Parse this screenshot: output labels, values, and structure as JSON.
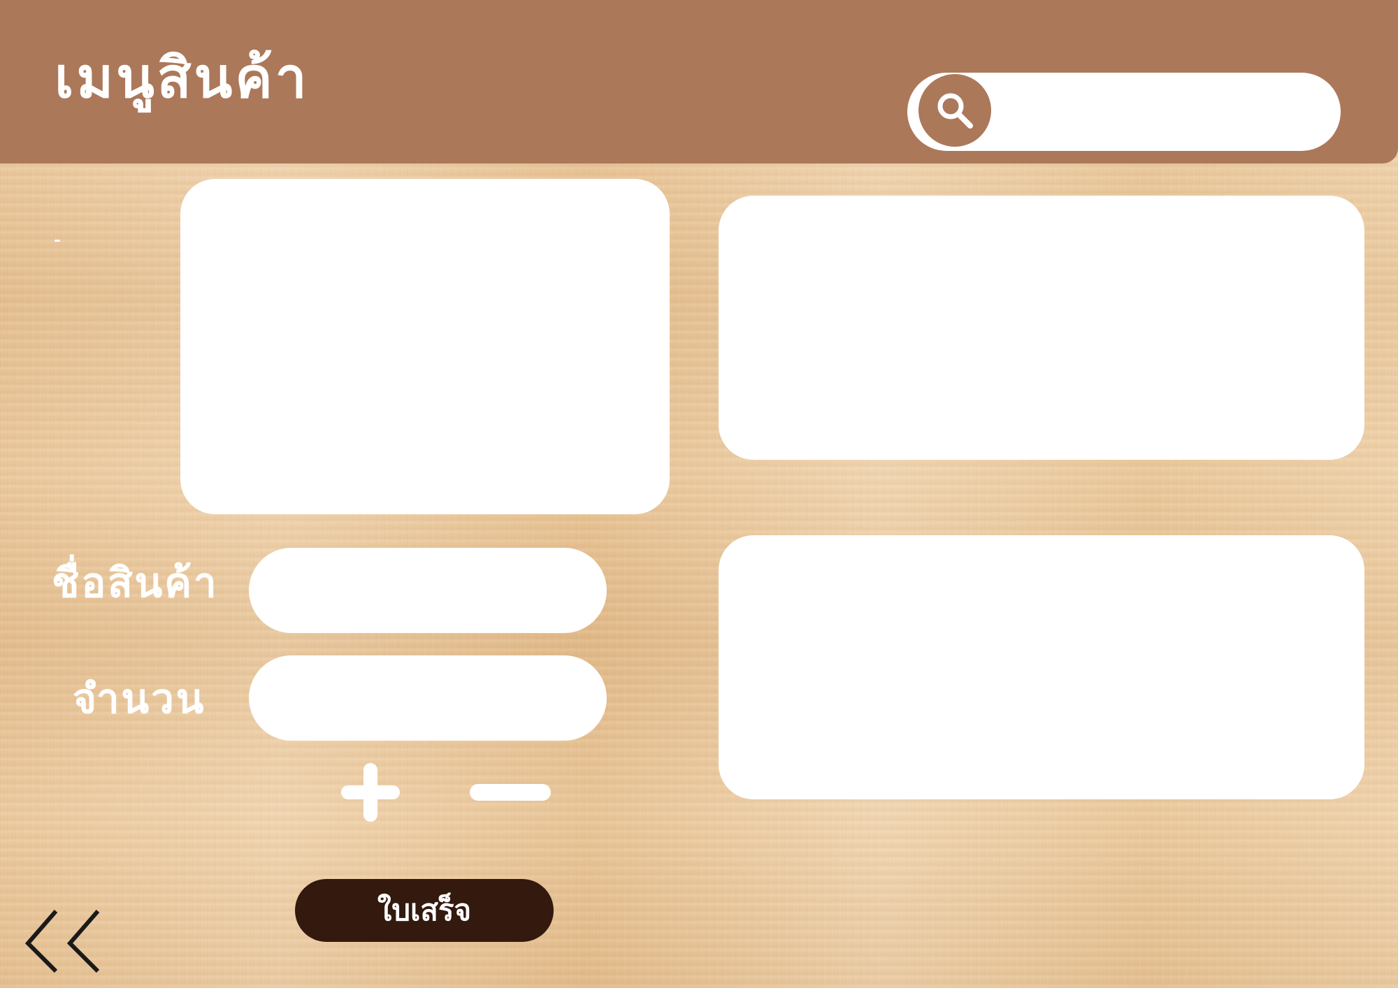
{
  "header": {
    "title": "เมนูสินค้า",
    "color": "#ac785a"
  },
  "search": {
    "value": "",
    "placeholder": "",
    "icon": "search-icon"
  },
  "form": {
    "product_name_label": "ชื่อสินค้า",
    "product_name_value": "",
    "quantity_label": "จำนวน",
    "quantity_value": "",
    "plus_icon": "plus-icon",
    "minus_icon": "minus-icon"
  },
  "actions": {
    "receipt_label": "ใบเสร็จ",
    "receipt_color": "#33190e",
    "back_icon": "double-chevron-left-icon"
  },
  "theme": {
    "background": "wood-texture",
    "panel_color": "#ffffff"
  }
}
